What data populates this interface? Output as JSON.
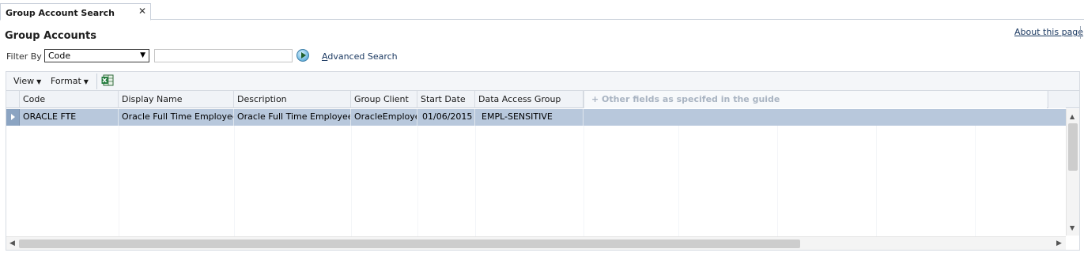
{
  "tab": {
    "title": "Group Account Search",
    "close": "✕"
  },
  "page": {
    "title": "Group Accounts",
    "about": "About this page"
  },
  "filter": {
    "label": "Filter By",
    "selected": "Code",
    "value": "",
    "advanced_search": "Advanced Search"
  },
  "toolbar": {
    "view": "View",
    "format": "Format"
  },
  "columns": [
    "Code",
    "Display Name",
    "Description",
    "Group Client",
    "Start Date",
    "Data Access Group"
  ],
  "hint": "+ Other fields as specifed in the guide",
  "rows": [
    {
      "code": "ORACLE FTE",
      "display_name": "Oracle Full Time Employees",
      "description": "Oracle Full Time Employees",
      "group_client": "OracleEmployees",
      "start_date": "01/06/2015",
      "data_access_group": "EMPL-SENSITIVE"
    }
  ],
  "colors": {
    "selected_row": "#b8c8dc",
    "link": "#1c3a62",
    "hint_text": "#a9b4c2"
  },
  "icons": [
    "close-icon",
    "go-icon",
    "excel-export-icon",
    "row-selector-icon",
    "scroll-up-icon",
    "scroll-down-icon",
    "scroll-left-icon",
    "scroll-right-icon"
  ]
}
